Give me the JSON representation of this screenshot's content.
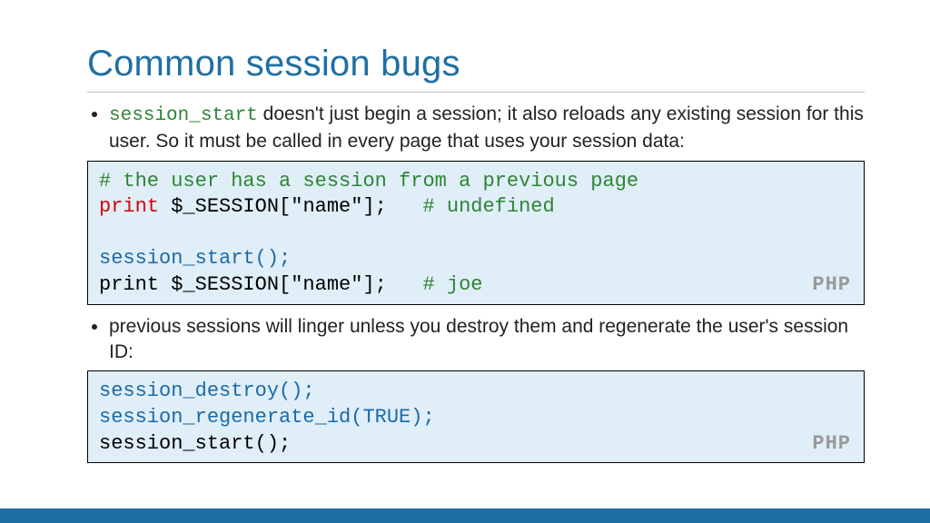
{
  "title": "Common session bugs",
  "bullet1_code": "session_start",
  "bullet1_rest": " doesn't just begin a session; it also reloads any existing session for this user. So it must be called in every page that uses your session data:",
  "code1": {
    "line1": "# the user has a session from a previous page",
    "line2a": "print",
    "line2b": " $_SESSION[\"name\"];   ",
    "line2c": "# undefined",
    "blank": "",
    "line3": "session_start();",
    "line4a": "print $_SESSION[\"name\"];   ",
    "line4b": "# joe",
    "lang": "PHP"
  },
  "bullet2": "previous sessions will linger unless you destroy them and regenerate the user's session ID:",
  "code2": {
    "line1": "session_destroy();",
    "line2": "session_regenerate_id(TRUE);",
    "line3": "session_start();",
    "lang": "PHP"
  }
}
